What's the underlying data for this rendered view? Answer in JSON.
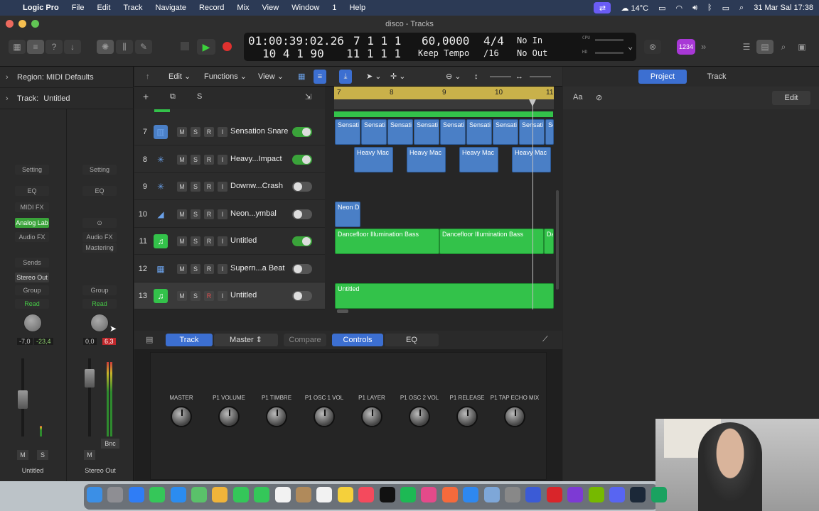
{
  "menubar": {
    "app": "Logic Pro",
    "items": [
      "File",
      "Edit",
      "Track",
      "Navigate",
      "Record",
      "Mix",
      "View",
      "Window",
      "1",
      "Help"
    ],
    "temperature": "14°C",
    "datetime": "31 Mar Sal  17:38"
  },
  "window": {
    "title": "disco - Tracks"
  },
  "lcd": {
    "time": "01:00:39:02.26",
    "bars_top": "7  1  1     1",
    "bars_bottom": "10  4  1    90",
    "bars_bottom2": "11  1  1     1",
    "tempo": "60,0000",
    "tempo_mode": "Keep Tempo",
    "signature": "4/4",
    "division": "/16",
    "in": "No In",
    "out": "No Out",
    "cpu": "CPU",
    "hd": "HD"
  },
  "toolbar": {
    "badge": "1234"
  },
  "inspector": {
    "region_label": "Region: MIDI Defaults",
    "track_label": "Track:",
    "track_value": "Untitled",
    "strip1": {
      "setting": "Setting",
      "eq": "EQ",
      "midi_fx": "MIDI FX",
      "instrument": "Analog Lab",
      "audio_fx": "Audio FX",
      "sends": "Sends",
      "output": "Stereo Out",
      "group": "Group",
      "automation": "Read",
      "pan": "-7,0",
      "volume": "-23,4",
      "mute": "M",
      "solo": "S",
      "name": "Untitled"
    },
    "strip2": {
      "setting": "Setting",
      "eq": "EQ",
      "audio_fx": "Audio FX",
      "mastering": "Mastering",
      "group": "Group",
      "automation": "Read",
      "pan": "0,0",
      "volume": "6,3",
      "bounce": "Bnc",
      "mute": "M",
      "name": "Stereo Out"
    }
  },
  "tracks_header": {
    "edit": "Edit",
    "functions": "Functions",
    "view": "View",
    "solo": "S"
  },
  "ruler": [
    "7",
    "8",
    "9",
    "10",
    "11"
  ],
  "tracks": [
    {
      "num": "7",
      "name": "Sensation Snare",
      "icon": "drum-icon"
    },
    {
      "num": "8",
      "name": "Heavy...Impact",
      "icon": "snowflake-icon"
    },
    {
      "num": "9",
      "name": "Downw...Crash",
      "icon": "snowflake-icon"
    },
    {
      "num": "10",
      "name": "Neon...ymbal",
      "icon": "cymbal-icon"
    },
    {
      "num": "11",
      "name": "Untitled",
      "icon": "note-icon"
    },
    {
      "num": "12",
      "name": "Supern...a Beat",
      "icon": "drum-machine-icon"
    },
    {
      "num": "13",
      "name": "Untitled",
      "icon": "note-icon"
    }
  ],
  "msri": {
    "m": "M",
    "s": "S",
    "r": "R",
    "i": "I"
  },
  "regions": {
    "sensation": "Sensati",
    "heavy": "Heavy Mac",
    "neon": "Neon D",
    "dancefloor": "Dancefloor Illumination Bass",
    "dancefloor_short": "Da",
    "untitled": "Untitled",
    "se": "Se"
  },
  "smart_controls": {
    "tabs": [
      "Track",
      "Master",
      "Compare",
      "Controls",
      "EQ"
    ],
    "knobs": [
      "MASTER",
      "P1 VOLUME",
      "P1 TIMBRE",
      "P1 OSC 1 VOL",
      "P1 LAYER",
      "P1 OSC 2 VOL",
      "P1 RELEASE",
      "P1 TAP ECHO MIX"
    ]
  },
  "right_panel": {
    "tab_project": "Project",
    "tab_track": "Track",
    "aa": "Aa",
    "edit": "Edit"
  }
}
